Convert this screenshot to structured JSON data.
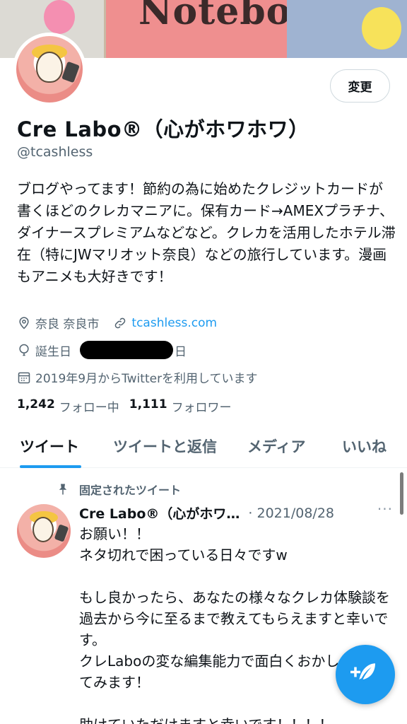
{
  "banner": {
    "title": "Notebook"
  },
  "profile": {
    "edit_label": "変更",
    "display_name": "Cre Labo®（心がホワホワ）",
    "handle": "@tcashless",
    "bio": "ブログやってます！節約の為に始めたクレジットカードが書くほどのクレカマニアに。保有カード→AMEXプラチナ、ダイナースプレミアムなどなど。クレカを活用したホテル滞在（特にJWマリオット奈良）などの旅行しています。漫画もアニメも大好きです！",
    "location": "奈良 奈良市",
    "website": "tcashless.com",
    "birthday_label": "誕生日",
    "birthday_tail": "日",
    "joined": "2019年9月からTwitterを利用しています",
    "following_count": "1,242",
    "following_label": "フォロー中",
    "followers_count": "1,111",
    "followers_label": "フォロワー"
  },
  "tabs": [
    {
      "label": "ツイート"
    },
    {
      "label": "ツイートと返信"
    },
    {
      "label": "メディア"
    },
    {
      "label": "いいね"
    }
  ],
  "pinned_tweet": {
    "pinned_label": "固定されたツイート",
    "author_name": "Cre Labo®（心がホワ…",
    "date": "· 2021/08/28",
    "more": "···",
    "body": "お願い！！\nネタ切れで困っている日々ですw\n\nもし良かったら、あなたの様々なクレカ体験談を過去から今に至るまで教えてもらえますと幸いです。\nクレLaboの変な編集能力で面白くおかしく書いてみます！\n\n助けていただけますと幸いです！！！！"
  },
  "colors": {
    "accent": "#1d9bf0",
    "banner": "#ef8f8f",
    "secondary_text": "#536471"
  },
  "icons": [
    "location-icon",
    "link-icon",
    "birthday-icon",
    "calendar-icon",
    "pin-icon",
    "compose-tweet-icon"
  ]
}
